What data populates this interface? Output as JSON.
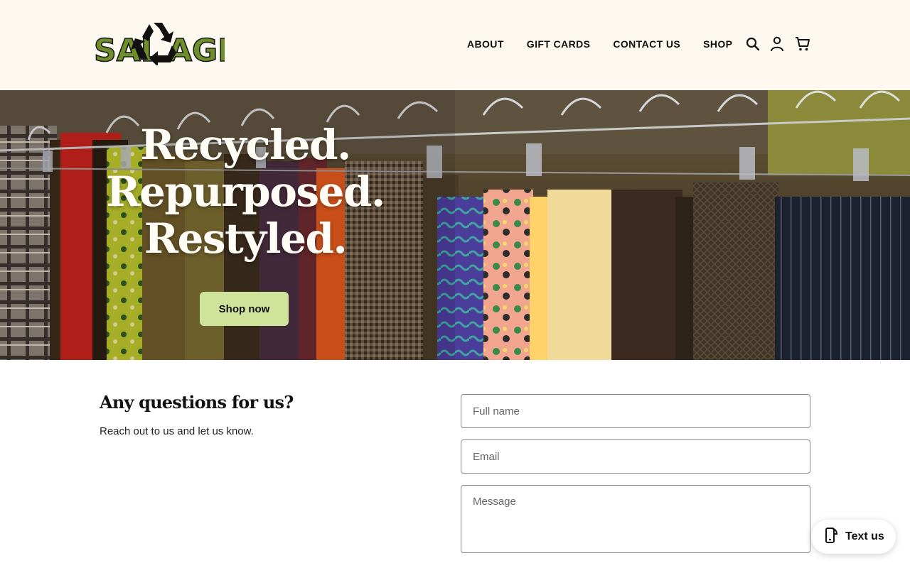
{
  "brand": {
    "logo_text": "SALVAGE",
    "logo_color": "#6e8f2a"
  },
  "nav": {
    "items": [
      {
        "label": "ABOUT"
      },
      {
        "label": "GIFT CARDS"
      },
      {
        "label": "CONTACT US"
      },
      {
        "label": "SHOP"
      }
    ],
    "icons": [
      "search-icon",
      "account-icon",
      "cart-icon"
    ]
  },
  "hero": {
    "lines": [
      "Recycled.",
      "Repurposed.",
      "Restyled."
    ],
    "cta_label": "Shop now",
    "cta_color": "#cfe39a"
  },
  "contact": {
    "title": "Any questions for us?",
    "subtitle": "Reach out to us and let us know.",
    "name_placeholder": "Full name",
    "email_placeholder": "Email",
    "message_placeholder": "Message"
  },
  "chat": {
    "label": "Text us",
    "icon": "chat-phone-icon"
  },
  "colors": {
    "header_bg": "#fdf8f0",
    "accent": "#cfe39a"
  }
}
